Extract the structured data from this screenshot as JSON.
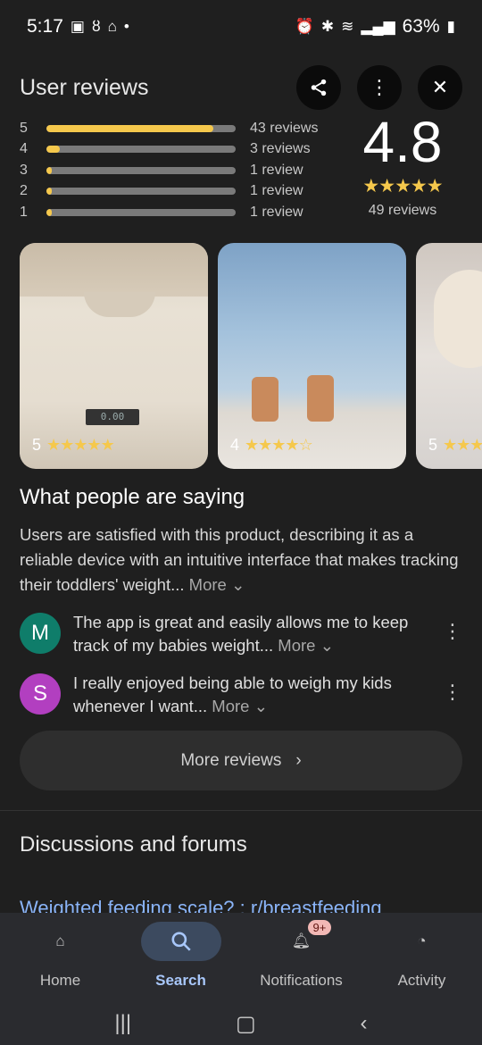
{
  "status_bar": {
    "time": "5:17",
    "battery": "63%"
  },
  "header": {
    "title": "User reviews"
  },
  "ratings": [
    {
      "stars": "5",
      "count_text": "43 reviews",
      "fraction": 0.88
    },
    {
      "stars": "4",
      "count_text": "3 reviews",
      "fraction": 0.07
    },
    {
      "stars": "3",
      "count_text": "1 review",
      "fraction": 0.03
    },
    {
      "stars": "2",
      "count_text": "1 review",
      "fraction": 0.03
    },
    {
      "stars": "1",
      "count_text": "1 review",
      "fraction": 0.03
    }
  ],
  "overall": {
    "score": "4.8",
    "stars": "★★★★★",
    "total": "49 reviews",
    "star_color": "#f5c84c"
  },
  "photos": [
    {
      "rating": "5",
      "stars": "★★★★★",
      "lcd": "0.00"
    },
    {
      "rating": "4",
      "stars": "★★★★☆"
    },
    {
      "rating": "5",
      "stars": "★★★"
    }
  ],
  "saying": {
    "title": "What people are saying",
    "body": "Users are satisfied with this product, describing it as a reliable device with an intuitive interface that makes tracking their toddlers' weight...",
    "more": "More ⌄"
  },
  "reviews": [
    {
      "initial": "M",
      "color": "#0f7d6a",
      "text": "The app is great and easily allows me to keep track of my babies weight...",
      "more": "More ⌄"
    },
    {
      "initial": "S",
      "color": "#b23fc0",
      "text": "I really enjoyed being able to weigh my kids whenever I want...",
      "more": "More ⌄"
    }
  ],
  "more_reviews": "More reviews",
  "discussions": {
    "title": "Discussions and forums",
    "link": "Weighted feeding scale? : r/breastfeeding"
  },
  "nav": {
    "home": "Home",
    "search": "Search",
    "notifications": "Notifications",
    "activity": "Activity",
    "badge": "9+"
  }
}
